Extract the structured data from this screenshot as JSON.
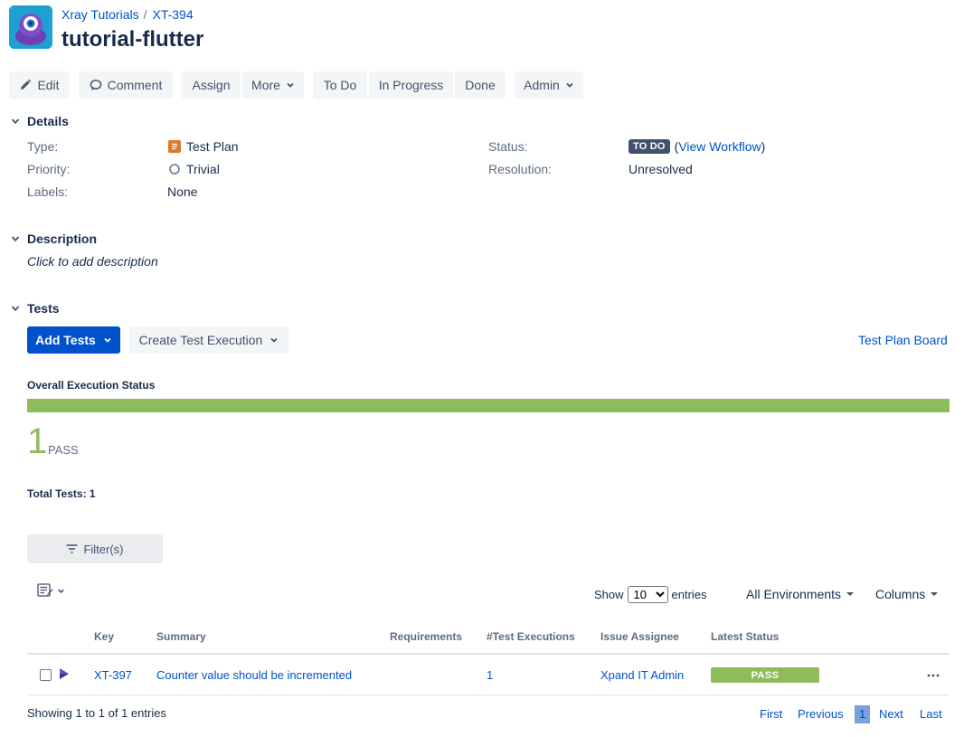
{
  "breadcrumb": {
    "project": "Xray Tutorials",
    "separator": "/",
    "issue_key": "XT-394"
  },
  "page_title": "tutorial-flutter",
  "toolbar": {
    "edit": "Edit",
    "comment": "Comment",
    "assign": "Assign",
    "more": "More",
    "todo": "To Do",
    "in_progress": "In Progress",
    "done": "Done",
    "admin": "Admin"
  },
  "details": {
    "heading": "Details",
    "type_label": "Type:",
    "type_value": "Test Plan",
    "priority_label": "Priority:",
    "priority_value": "Trivial",
    "labels_label": "Labels:",
    "labels_value": "None",
    "status_label": "Status:",
    "status_value": "TO DO",
    "view_workflow": "View Workflow",
    "paren_open": "(",
    "paren_close": ")",
    "resolution_label": "Resolution:",
    "resolution_value": "Unresolved"
  },
  "description": {
    "heading": "Description",
    "placeholder": "Click to add description"
  },
  "tests": {
    "heading": "Tests",
    "add_tests": "Add Tests",
    "create_execution": "Create Test Execution",
    "board_link": "Test Plan Board",
    "overall_status_label": "Overall Execution Status",
    "pass_fraction": 1.0,
    "pass_count": "1",
    "pass_label": "PASS",
    "total_tests": "Total Tests: 1",
    "filter_button": "Filter(s)",
    "show_label": "Show",
    "entries_options": [
      "10"
    ],
    "entries_label": "entries",
    "environments": "All Environments",
    "columns": "Columns",
    "table": {
      "headers": [
        "Key",
        "Summary",
        "Requirements",
        "#Test Executions",
        "Issue Assignee",
        "Latest Status"
      ],
      "rows": [
        {
          "key": "XT-397",
          "summary": "Counter value should be incremented",
          "requirements": "",
          "executions": "1",
          "assignee": "Xpand IT Admin",
          "status": "PASS"
        }
      ]
    },
    "showing": "Showing 1 to 1 of 1 entries",
    "pager": {
      "first": "First",
      "previous": "Previous",
      "current": "1",
      "next": "Next",
      "last": "Last"
    }
  },
  "colors": {
    "primary": "#0052cc",
    "pass": "#8ebc5b",
    "todo_lozenge": "#42526e",
    "project_avatar": "#1fa0d3",
    "test_plan_icon": "#e0792f",
    "test_icon": "#6554c0"
  }
}
